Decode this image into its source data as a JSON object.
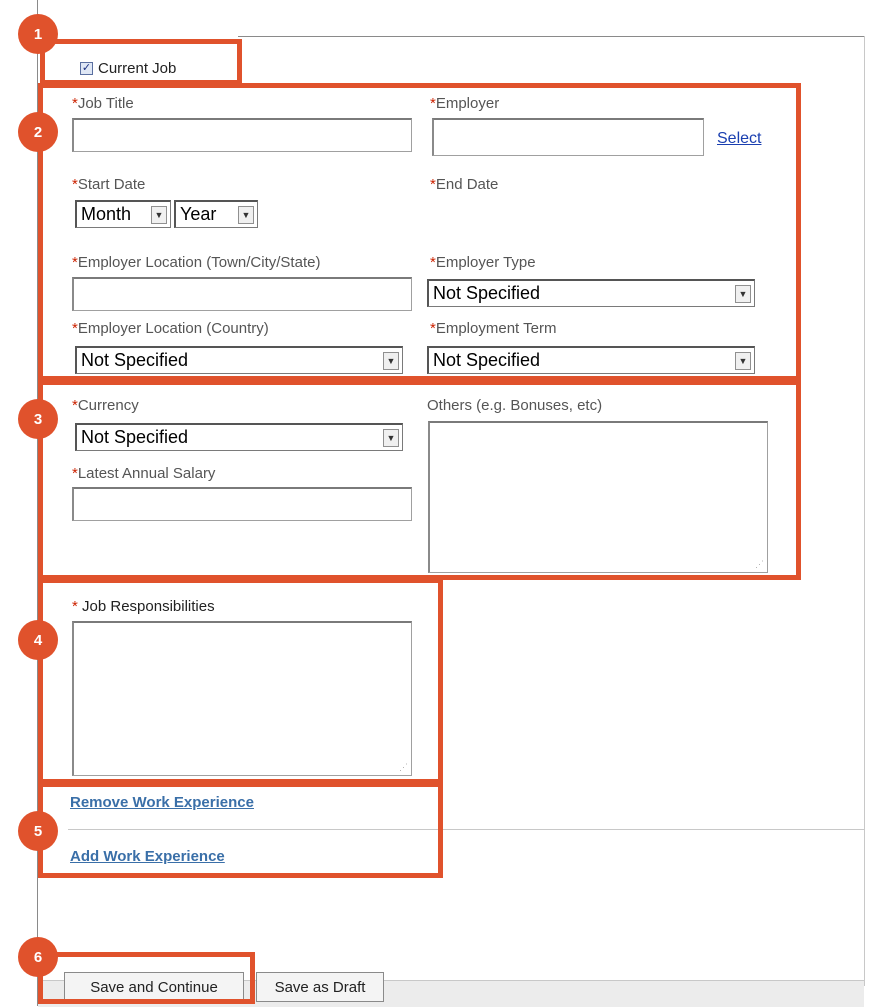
{
  "current_job": {
    "label": "Current Job",
    "checked": true
  },
  "fields": {
    "job_title": {
      "label": "Job Title",
      "value": ""
    },
    "employer": {
      "label": "Employer",
      "value": "",
      "select_link": "Select"
    },
    "start_date": {
      "label": "Start Date",
      "month": "Month",
      "year": "Year"
    },
    "end_date": {
      "label": "End Date"
    },
    "employer_location_town": {
      "label": "Employer Location (Town/City/State)",
      "value": ""
    },
    "employer_type": {
      "label": "Employer Type",
      "selected": "Not Specified"
    },
    "employer_location_country": {
      "label": "Employer Location (Country)",
      "selected": "Not Specified"
    },
    "employment_term": {
      "label": "Employment Term",
      "selected": "Not Specified"
    },
    "currency": {
      "label": "Currency",
      "selected": "Not Specified"
    },
    "others": {
      "label": "Others (e.g. Bonuses, etc)",
      "value": ""
    },
    "latest_annual_salary": {
      "label": "Latest Annual Salary",
      "value": ""
    },
    "job_responsibilities": {
      "label": "Job Responsibilities",
      "value": ""
    }
  },
  "required_mark": "*",
  "links": {
    "remove_work_experience": "Remove Work Experience",
    "add_work_experience": "Add Work Experience"
  },
  "buttons": {
    "save_and_continue": "Save and Continue",
    "save_as_draft": "Save as Draft"
  },
  "callouts": [
    "1",
    "2",
    "3",
    "4",
    "5",
    "6"
  ],
  "colors": {
    "callout": "#e0522c",
    "required": "#cc2200",
    "link": "#1a3fb0",
    "link_bold": "#3a6fa8"
  },
  "icons": {
    "dropdown": "chevron-down-icon",
    "checkbox": "check-icon"
  }
}
